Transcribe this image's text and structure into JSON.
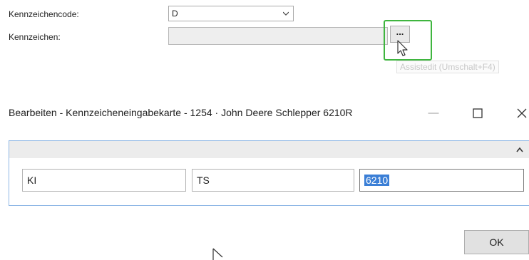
{
  "form": {
    "code_label": "Kennzeichencode:",
    "code_value": "D",
    "plate_label": "Kennzeichen:",
    "plate_value": "",
    "assist_label": "...",
    "assist_tooltip": "Assistedit (Umschalt+F4)"
  },
  "dialog": {
    "title": "Bearbeiten - Kennzeicheneingabekarte - 1254 · John Deere Schlepper 6210R",
    "fields": [
      "KI",
      "TS",
      "6210"
    ],
    "ok_label": "OK"
  },
  "colors": {
    "highlight_border": "#3fb53f",
    "selection": "#3b7fd6",
    "panel_border": "#8fb7e6"
  },
  "icons": [
    "chevron-down-icon",
    "cursor-arrow-icon",
    "minimize-icon",
    "maximize-icon",
    "close-icon",
    "chevron-up-icon"
  ]
}
